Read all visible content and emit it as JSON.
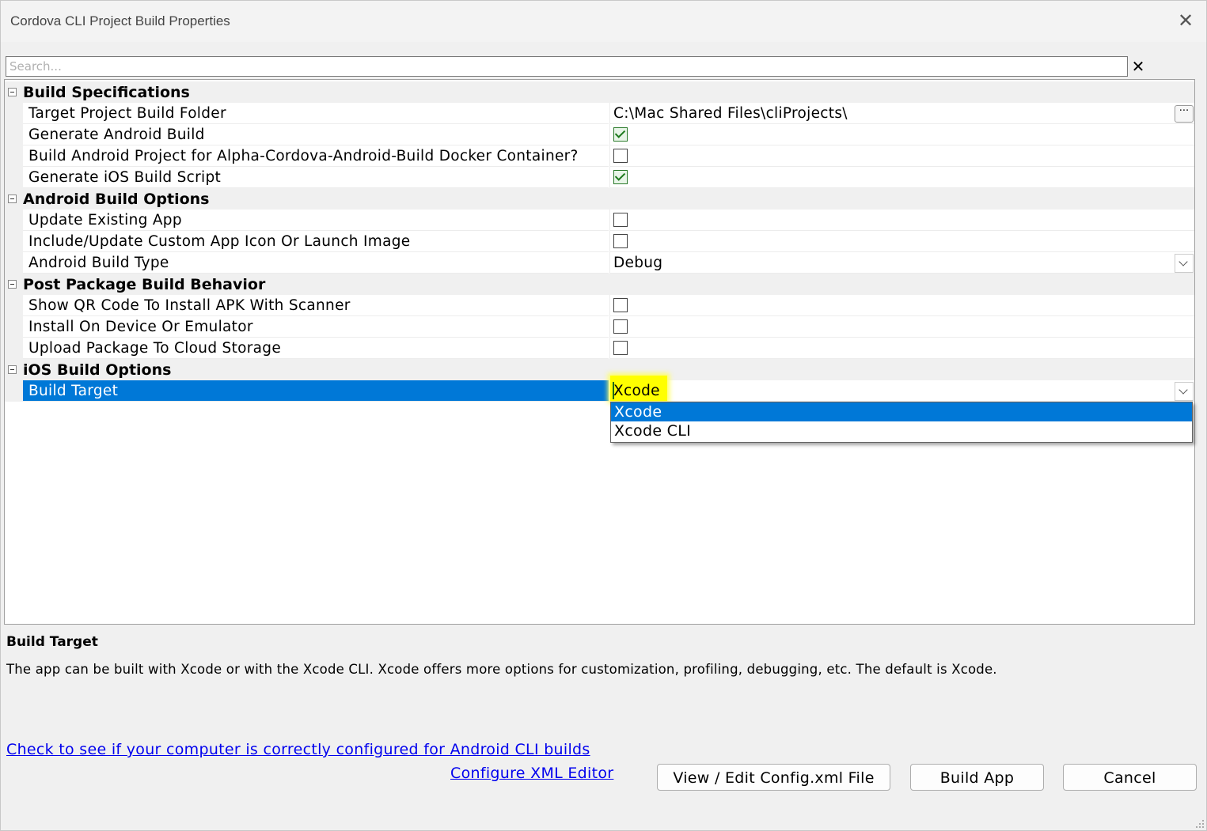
{
  "window": {
    "title": "Cordova CLI Project Build Properties"
  },
  "search": {
    "placeholder": "Search..."
  },
  "grid": {
    "categories": [
      {
        "label": "Build Specifications",
        "properties": [
          {
            "name": "Target Project Build Folder",
            "type": "text",
            "value": "C:\\Mac Shared Files\\cliProjects\\",
            "has_ellipsis": true
          },
          {
            "name": "Generate Android Build",
            "type": "checkbox",
            "checked": true
          },
          {
            "name": "Build Android Project for Alpha-Cordova-Android-Build Docker Container?",
            "type": "checkbox",
            "checked": false
          },
          {
            "name": "Generate iOS Build Script",
            "type": "checkbox",
            "checked": true
          }
        ]
      },
      {
        "label": "Android Build Options",
        "properties": [
          {
            "name": "Update Existing App",
            "type": "checkbox",
            "checked": false
          },
          {
            "name": "Include/Update Custom App Icon Or Launch Image",
            "type": "checkbox",
            "checked": false
          },
          {
            "name": "Android Build Type",
            "type": "dropdown",
            "value": "Debug"
          }
        ]
      },
      {
        "label": "Post Package Build Behavior",
        "properties": [
          {
            "name": "Show QR Code To Install APK With Scanner",
            "type": "checkbox",
            "checked": false
          },
          {
            "name": "Install On Device Or Emulator",
            "type": "checkbox",
            "checked": false
          },
          {
            "name": "Upload Package To Cloud Storage",
            "type": "checkbox",
            "checked": false
          }
        ]
      },
      {
        "label": "iOS Build Options",
        "properties": [
          {
            "name": "Build Target",
            "type": "dropdown",
            "value": "Xcode",
            "selected": true
          }
        ]
      }
    ],
    "open_dropdown": {
      "options": [
        "Xcode",
        "Xcode CLI"
      ],
      "active_index": 0
    }
  },
  "description": {
    "title": "Build Target",
    "body": "The app can be built with Xcode or with the Xcode CLI. Xcode offers more options for customization, profiling, debugging, etc. The default is Xcode."
  },
  "links": {
    "android_check": "Check to see if your computer is correctly configured for Android CLI builds",
    "xml_editor": "Configure XML Editor"
  },
  "buttons": {
    "view_edit": "View / Edit Config.xml File",
    "build": "Build App",
    "cancel": "Cancel"
  },
  "colors": {
    "selection": "#0078d7",
    "highlight": "#ffff00",
    "link": "#0000ee"
  }
}
